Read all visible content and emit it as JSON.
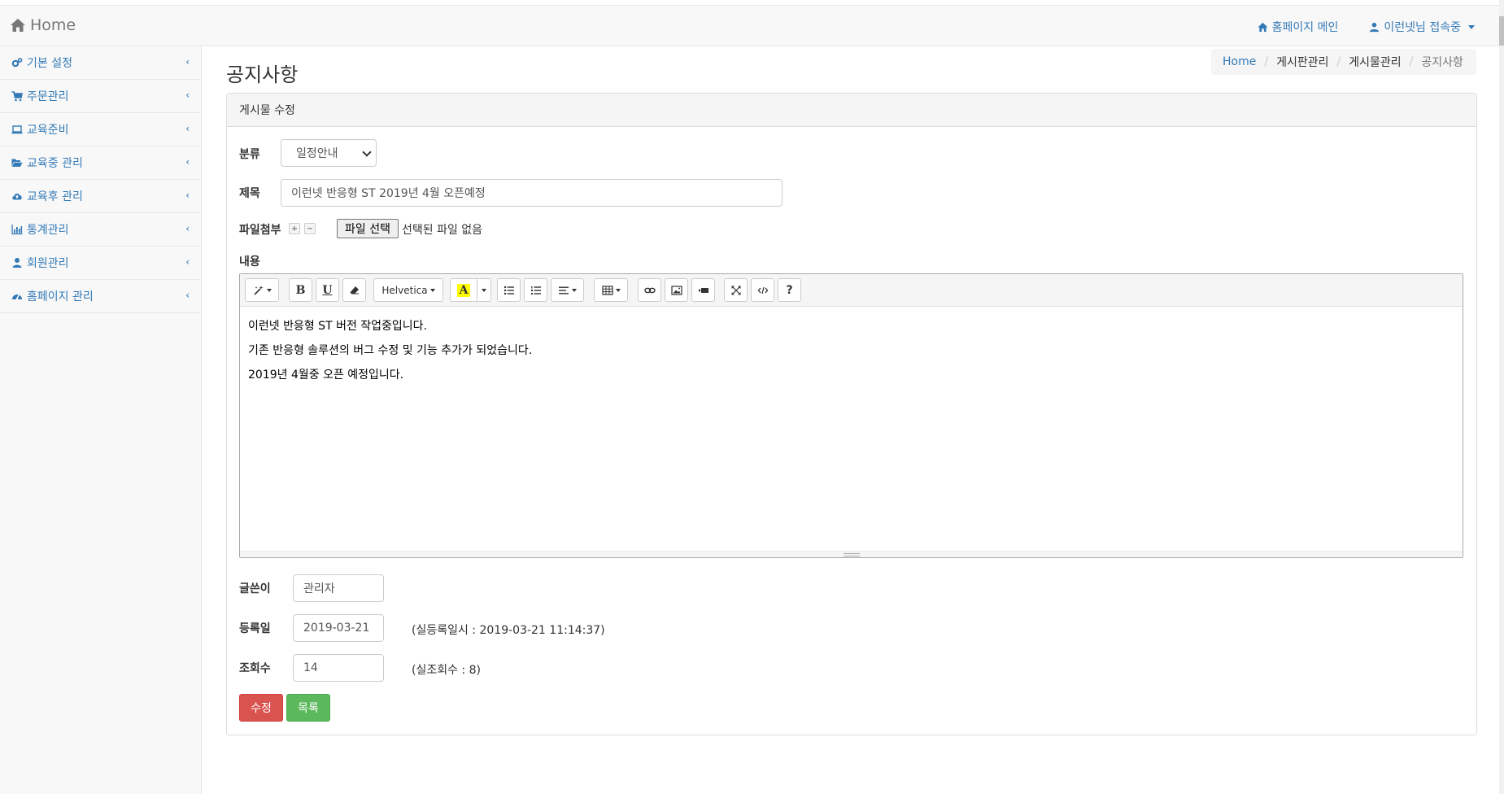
{
  "header": {
    "brand": "Home",
    "links": [
      {
        "label": "홈페이지 메인",
        "icon": "home-icon"
      },
      {
        "label": "이런넷님 접속중",
        "icon": "user-icon"
      }
    ]
  },
  "sidebar": {
    "items": [
      {
        "label": "기본 설정",
        "icon": "cogs-icon"
      },
      {
        "label": "주문관리",
        "icon": "cart-icon"
      },
      {
        "label": "교육준비",
        "icon": "laptop-icon"
      },
      {
        "label": "교육중 관리",
        "icon": "folder-open-icon"
      },
      {
        "label": "교육후 관리",
        "icon": "cloud-upload-icon"
      },
      {
        "label": "통계관리",
        "icon": "bar-chart-icon"
      },
      {
        "label": "회원관리",
        "icon": "user-icon"
      },
      {
        "label": "홈페이지 관리",
        "icon": "dashboard-icon"
      }
    ],
    "chevron": "‹"
  },
  "page": {
    "title": "공지사항",
    "breadcrumb": [
      "Home",
      "게시판관리",
      "게시물관리",
      "공지사항"
    ]
  },
  "panel": {
    "heading": "게시물 수정"
  },
  "form": {
    "category": {
      "label": "분류",
      "value": "일정안내"
    },
    "subject": {
      "label": "제목",
      "value": "이런넷 반응형 ST 2019년 4월 오픈예정"
    },
    "attachment": {
      "label": "파일첨부",
      "plus": "+",
      "minus": "−",
      "button": "파일 선택",
      "status": "선택된 파일 없음"
    },
    "content": {
      "label": "내용",
      "font": "Helvetica",
      "help": "?",
      "lines": [
        "이런넷 반응형 ST 버전 작업중입니다.",
        "기존 반응형 솔루션의 버그 수정 및 기능 추가가 되었습니다.",
        "2019년 4월중 오픈 예정입니다."
      ]
    },
    "writer": {
      "label": "글쓴이",
      "value": "관리자"
    },
    "date": {
      "label": "등록일",
      "value": "2019-03-21",
      "note": "(실등록일시 : 2019-03-21 11:14:37)"
    },
    "views": {
      "label": "조회수",
      "value": "14",
      "note": "(실조회수 : 8)"
    },
    "submit_label": "수정",
    "list_label": "목록"
  },
  "colors": {
    "link": "#337ab7",
    "danger": "#d9534f",
    "success": "#5cb85c",
    "highlight": "#ffff00"
  }
}
